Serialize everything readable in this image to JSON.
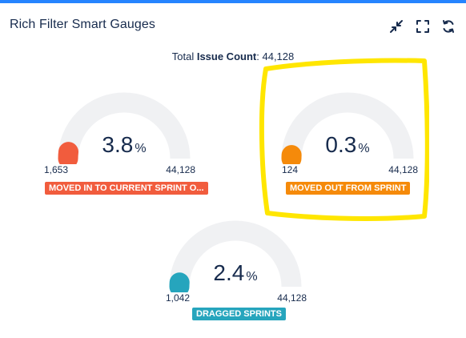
{
  "header": {
    "title": "Rich Filter Smart Gauges",
    "buttons": [
      {
        "name": "minimize-icon",
        "label": ""
      },
      {
        "name": "fullscreen-icon",
        "label": ""
      },
      {
        "name": "refresh-icon",
        "label": ""
      }
    ]
  },
  "total": {
    "prefix": "Total ",
    "label": "Issue Count",
    "colon": ":",
    "value": "44,128"
  },
  "gauges": [
    {
      "value_text": "3.8",
      "percent_sign": "%",
      "fraction": 0.038,
      "min": "1,653",
      "max": "44,128",
      "label": "MOVED IN TO CURRENT SPRINT O...",
      "color": "#f15c3d"
    },
    {
      "value_text": "0.3",
      "percent_sign": "%",
      "fraction": 0.003,
      "min": "124",
      "max": "44,128",
      "label": "MOVED OUT FROM SPRINT",
      "color": "#f58a0a"
    },
    {
      "value_text": "2.4",
      "percent_sign": "%",
      "fraction": 0.024,
      "min": "1,042",
      "max": "44,128",
      "label": "DRAGGED SPRINTS",
      "color": "#26a5bd"
    }
  ],
  "colors": {
    "track": "#f0f1f3",
    "text": "#172b4d",
    "accent_bar": "#2684ff",
    "highlight_marker": "#ffe600"
  }
}
